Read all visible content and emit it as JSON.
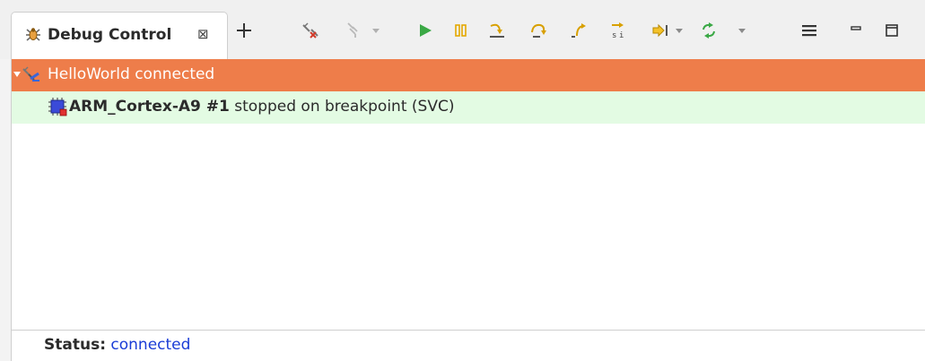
{
  "view": {
    "title": "Debug Control",
    "close_glyph": "⊠",
    "add_glyph": "+"
  },
  "toolbar": {
    "icons": [
      "disconnect-icon",
      "connect-icon",
      "dropdown-arrow-icon",
      "continue-icon",
      "pause-icon",
      "step-into-icon",
      "step-over-icon",
      "step-out-icon",
      "step-instruction-icon",
      "run-to-line-icon",
      "dropdown-arrow-icon",
      "refresh-icon",
      "dropdown-arrow-icon",
      "view-menu-icon",
      "minimize-icon",
      "maximize-icon"
    ]
  },
  "tree": {
    "connection": {
      "label": "HelloWorld connected",
      "expanded": true,
      "color": "#ee7d4a"
    },
    "core": {
      "name": "ARM_Cortex-A9 #1",
      "state": "stopped on breakpoint (SVC)",
      "color": "#e3fbe3"
    }
  },
  "status": {
    "label": "Status:",
    "value": "connected",
    "value_color": "#1a3cd6"
  }
}
